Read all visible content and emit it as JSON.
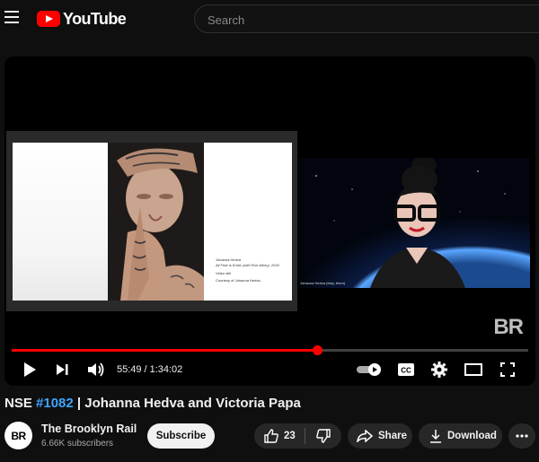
{
  "header": {
    "logo_text": "YouTube",
    "search_placeholder": "Search"
  },
  "player": {
    "slide": {
      "caption_artist": "Johanna Hedva",
      "caption_work": "All Fear is Erotic (with Ron Athey), 2024",
      "caption_medium": "Video still",
      "caption_credit": "Courtesy of Johanna Hedva."
    },
    "camera_label": "Johanna Hedva (they, them)",
    "watermark": "BR",
    "current_time": "55:49",
    "time_separator": "/",
    "duration": "1:34:02",
    "progress_fraction": 0.592,
    "accent_color": "#ff0000"
  },
  "video": {
    "title_prefix": "NSE ",
    "title_tag": "#1082",
    "title_rest": " | Johanna Hedva and Victoria Papa"
  },
  "channel": {
    "avatar_text": "BR",
    "name": "The Brooklyn Rail",
    "subscribers": "6.66K subscribers",
    "subscribe_label": "Subscribe"
  },
  "actions": {
    "like_count": "23",
    "share_label": "Share",
    "download_label": "Download"
  }
}
